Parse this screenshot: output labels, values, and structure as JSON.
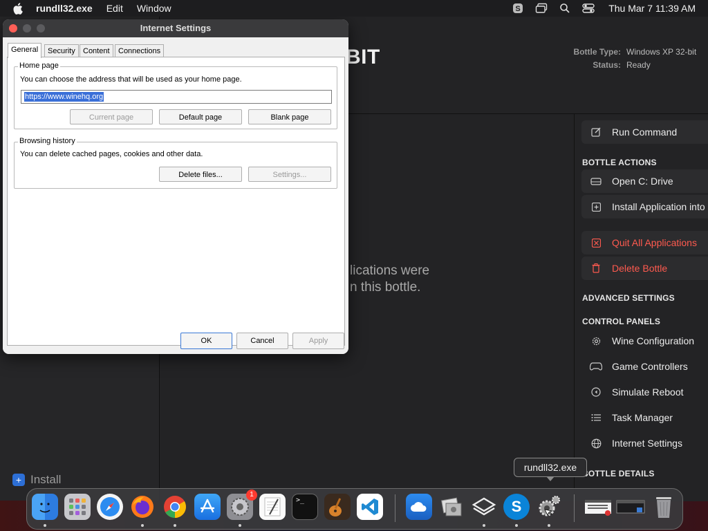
{
  "menubar": {
    "app_name": "rundll32.exe",
    "menus": [
      "Edit",
      "Window"
    ],
    "clock": "Thu Mar 7  11:39 AM",
    "icons": [
      "apple-icon",
      "skype-status-icon",
      "screen-mirror-icon",
      "spotlight-search-icon",
      "control-center-icon"
    ]
  },
  "bottle": {
    "title_fragment": "BIT",
    "type_label": "Bottle Type:",
    "type_value": "Windows XP 32-bit",
    "status_label": "Status:",
    "status_value": "Ready",
    "empty_line1": "lications were",
    "empty_line2": "n this bottle.",
    "install_label": "Install"
  },
  "right_panel": {
    "run_command": "Run Command",
    "bottle_actions_header": "BOTTLE ACTIONS",
    "open_c_drive": "Open C: Drive",
    "install_app": "Install Application into Bottle",
    "quit_all": "Quit All Applications",
    "delete_bottle": "Delete Bottle",
    "advanced_header": "ADVANCED SETTINGS",
    "control_panels_header": "CONTROL PANELS",
    "wine_config": "Wine Configuration",
    "game_controllers": "Game Controllers",
    "simulate_reboot": "Simulate Reboot",
    "task_manager": "Task Manager",
    "internet_settings": "Internet Settings",
    "bottle_details_header": "BOTTLE DETAILS",
    "danger_color": "#ff5a4f"
  },
  "dialog": {
    "title": "Internet Settings",
    "tabs": [
      "General",
      "Security",
      "Content",
      "Connections"
    ],
    "active_tab": "General",
    "home_page": {
      "label": "Home page",
      "desc": "You can choose the address that will be used as your home page.",
      "url": "https://www.winehq.org",
      "current_page": "Current page",
      "default_page": "Default page",
      "blank_page": "Blank page"
    },
    "history": {
      "label": "Browsing history",
      "desc": "You can delete cached pages, cookies and other data.",
      "delete_files": "Delete files...",
      "settings": "Settings..."
    },
    "ok": "OK",
    "cancel": "Cancel",
    "apply": "Apply"
  },
  "dock": {
    "tooltip": "rundll32.exe",
    "items": [
      "Finder",
      "Launchpad",
      "Safari",
      "Firefox",
      "Google Chrome",
      "App Store",
      "System Settings",
      "TextEdit",
      "Terminal",
      "GarageBand",
      "Visual Studio Code",
      "Weather",
      "Preview",
      "Whisky",
      "Skype",
      "rundll32.exe",
      "Minimized window",
      "Minimized window",
      "Trash"
    ],
    "settings_badge": "1"
  }
}
